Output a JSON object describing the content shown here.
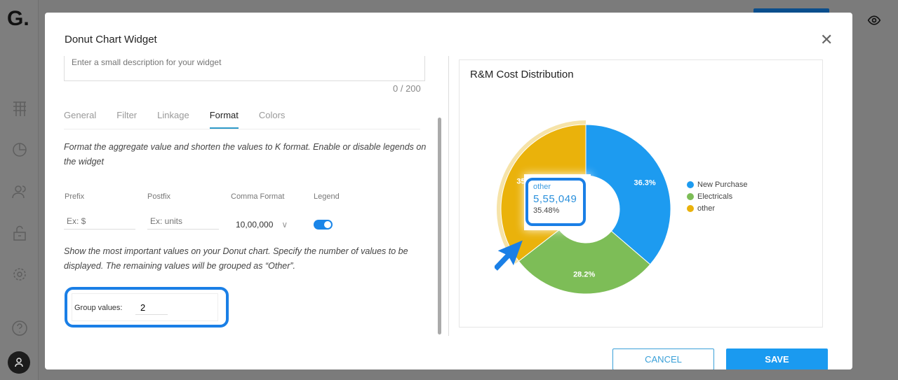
{
  "app": {
    "logo": "G."
  },
  "modal": {
    "title": "Donut Chart Widget",
    "description_placeholder": "Enter a small description for your widget",
    "char_count": "0 / 200",
    "tabs": [
      {
        "label": "General"
      },
      {
        "label": "Filter"
      },
      {
        "label": "Linkage"
      },
      {
        "label": "Format",
        "active": true
      },
      {
        "label": "Colors"
      }
    ],
    "format_help": "Format the aggregate value and shorten the values to K format. Enable or disable legends on the widget",
    "prefix": {
      "label": "Prefix",
      "placeholder": "Ex: $"
    },
    "postfix": {
      "label": "Postfix",
      "placeholder": "Ex: units"
    },
    "comma_format": {
      "label": "Comma Format",
      "value": "10,00,000"
    },
    "legend": {
      "label": "Legend",
      "enabled": true
    },
    "group_help": "Show the most important values on your Donut chart. Specify the number of values to be displayed. The remaining values will be grouped as “Other”.",
    "group_values": {
      "label": "Group values:",
      "value": "2"
    },
    "cancel_label": "CANCEL",
    "save_label": "SAVE"
  },
  "chart_data": {
    "type": "pie",
    "title": "R&M Cost Distribution",
    "donut": true,
    "categories": [
      "New Purchase",
      "Electricals",
      "other"
    ],
    "values": [
      36.3,
      28.2,
      35.5
    ],
    "labels": [
      "36.3%",
      "28.2%",
      "35.5%"
    ],
    "colors": [
      "#1d9bf0",
      "#7dbd57",
      "#eab20b"
    ],
    "legend_placement": "right",
    "tooltip": {
      "name": "other",
      "value": "5,55,049",
      "percent": "35.48%"
    }
  }
}
